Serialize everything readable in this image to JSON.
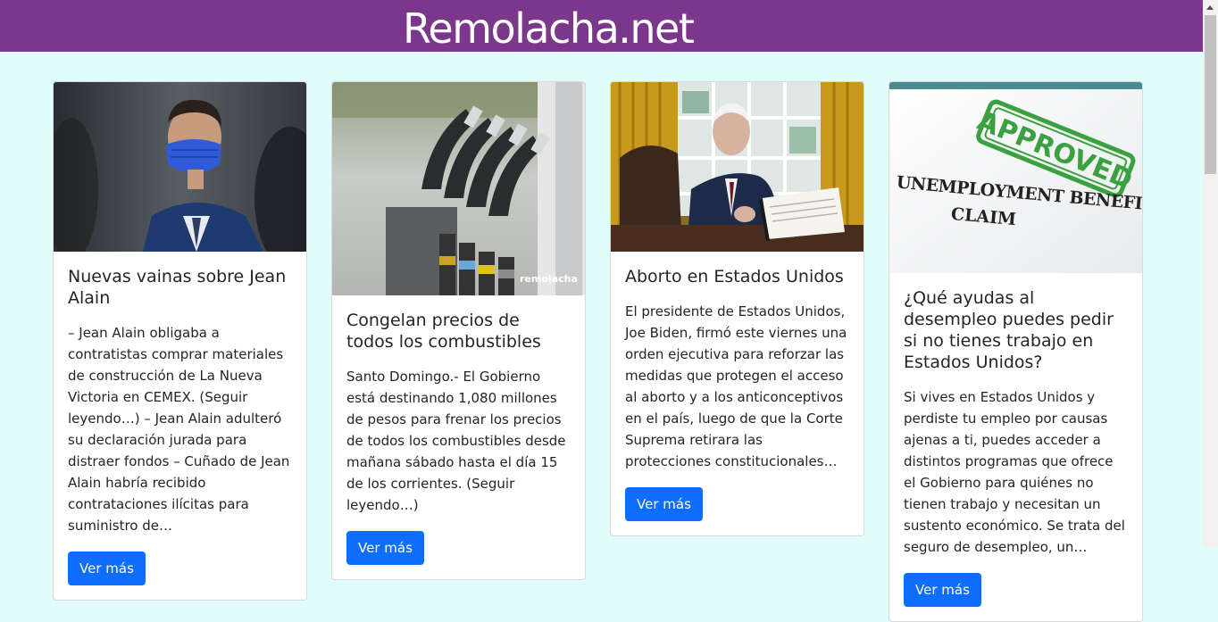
{
  "site": {
    "title": "Remolacha.net"
  },
  "cards": [
    {
      "title": "Nuevas vainas sobre Jean Alain",
      "text": "– Jean Alain obligaba a contratistas comprar materiales de construcción de La Nueva Victoria en CEMEX. (Seguir leyendo…) – Jean Alain adulteró su declaración jurada para distraer fondos – Cuñado de Jean Alain habría recibido contrataciones ilícitas para suministro de…",
      "button": "Ver más"
    },
    {
      "title": "Congelan precios de todos los combustibles",
      "text": "Santo Domingo.- El Gobierno está destinando 1,080 millones de pesos para frenar los precios de todos los combustibles desde mañana sábado hasta el día 15 de los corrientes. (Seguir leyendo…)",
      "button": "Ver más",
      "image_watermark": "remolacha"
    },
    {
      "title": "Aborto en Estados Unidos",
      "text": "El presidente de Estados Unidos, Joe Biden, firmó este viernes una orden ejecutiva para reforzar las medidas que protegen el acceso al aborto y a los anticonceptivos en el país, luego de que la Corte Suprema retirara las protecciones constitucionales…",
      "button": "Ver más"
    },
    {
      "title": "¿Qué ayudas al desempleo puedes pedir si no tienes trabajo en Estados Unidos?",
      "text": "Si vives en Estados Unidos y perdiste tu empleo por causas ajenas a ti, puedes acceder a distintos programas que ofrece el Gobierno para quiénes no tienen trabajo y necesitan un sustento económico. Se trata del seguro de desempleo, un…",
      "button": "Ver más",
      "image_text": {
        "stamp": "APPROVED",
        "line1": "UNEMPLOYMENT BENEFIT",
        "line2": "CLAIM"
      }
    }
  ],
  "colors": {
    "header": "#7a378b",
    "background": "#e0fdfc",
    "button": "#0d6efd"
  }
}
